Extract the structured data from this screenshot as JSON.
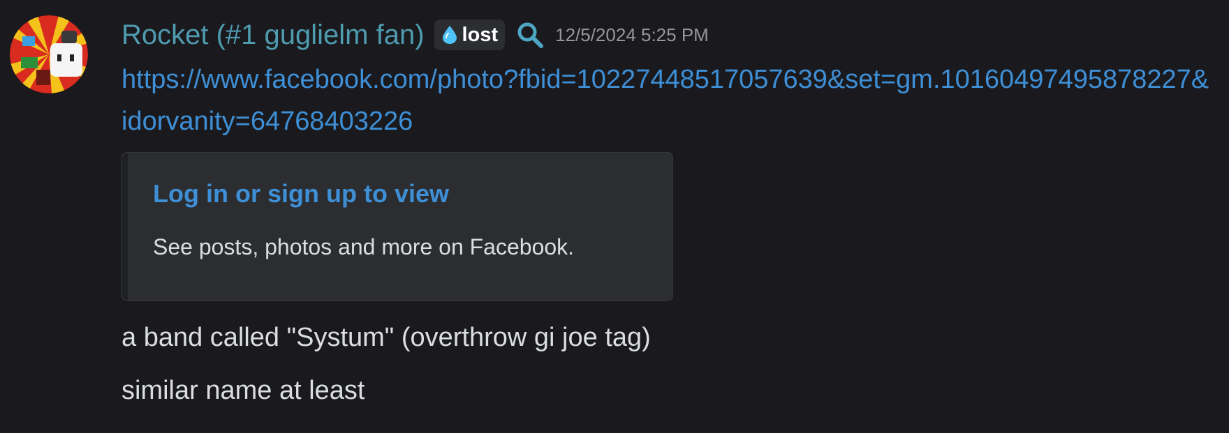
{
  "message": {
    "author": {
      "name": "Rocket (#1 guglielm fan)",
      "tag_icon": "water-drop-icon",
      "tag_text": "lost",
      "extra_icon": "search-icon"
    },
    "timestamp": "12/5/2024 5:25 PM",
    "link": "https://www.facebook.com/photo?fbid=10227448517057639&set=gm.10160497495878227&idorvanity=64768403226",
    "embed": {
      "title": "Log in or sign up to view",
      "description": "See posts, photos and more on Facebook."
    },
    "lines": [
      "a band called \"Systum\" (overthrow gi joe tag)",
      "similar name at least"
    ]
  },
  "colors": {
    "background": "#1a1a1e",
    "username": "#4f9bb0",
    "link": "#3e8fd6",
    "text": "#dbdee1",
    "timestamp": "#94979c",
    "embed_bg": "#2b2d31"
  }
}
